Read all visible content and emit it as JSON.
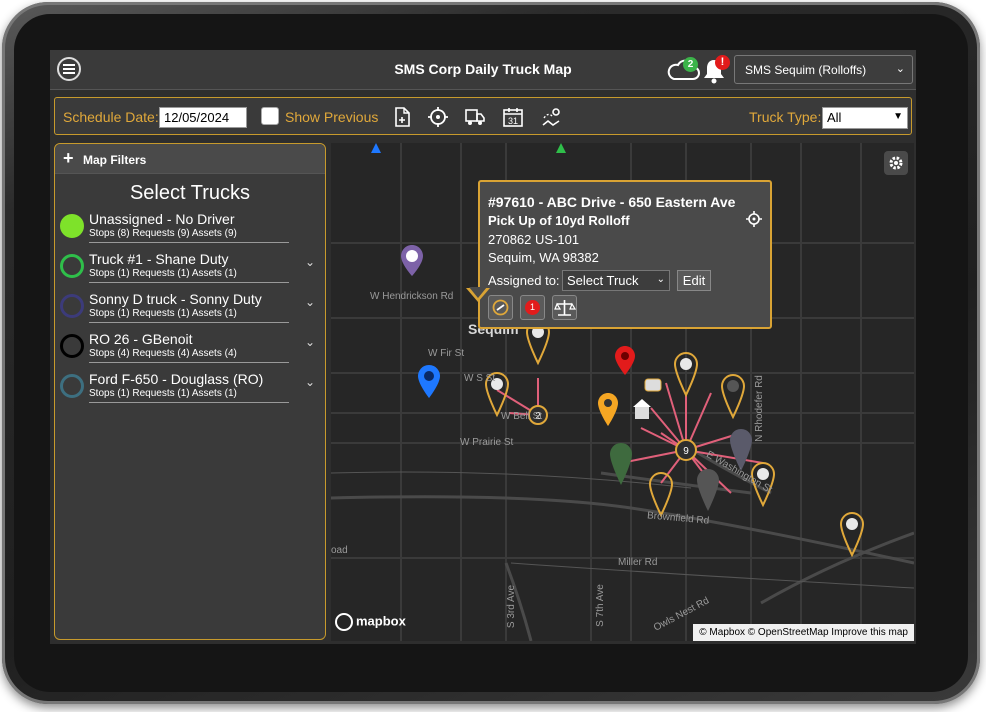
{
  "app": {
    "title": "SMS Corp Daily Truck Map",
    "cloud_count": "2",
    "alert_count": "!",
    "location": "SMS Sequim (Rolloffs)"
  },
  "toolbar": {
    "schedule_label": "Schedule Date:",
    "schedule_date": "12/05/2024",
    "show_previous_label": "Show Previous",
    "truck_type_label": "Truck Type:",
    "truck_type_value": "All"
  },
  "sidebar": {
    "filters_label": "Map Filters",
    "heading": "Select Trucks",
    "trucks": [
      {
        "name": "Unassigned - No Driver",
        "stats": "Stops (8) Requests (9) Assets (9)",
        "color": "#7ee22a",
        "filled": true,
        "expandable": false
      },
      {
        "name": "Truck #1 - Shane Duty",
        "stats": "Stops (1) Requests (1) Assets (1)",
        "color": "#2fbf4a",
        "filled": false,
        "expandable": true
      },
      {
        "name": "Sonny D truck - Sonny Duty",
        "stats": "Stops (1) Requests (1) Assets (1)",
        "color": "#3c3b7a",
        "filled": false,
        "expandable": true
      },
      {
        "name": "RO 26 - GBenoit",
        "stats": "Stops (4) Requests (4) Assets (4)",
        "color": "#000000",
        "filled": false,
        "expandable": true
      },
      {
        "name": "Ford F-650 - Douglass (RO)",
        "stats": "Stops (1) Requests (1) Assets (1)",
        "color": "#3d6f80",
        "filled": false,
        "expandable": true
      }
    ]
  },
  "map": {
    "town": "Sequim",
    "streets": {
      "hendrickson": "W Hendrickson Rd",
      "fir": "W Fir St",
      "w_st": "W S   St",
      "bell": "W Bell St",
      "prairie": "W Prairie St",
      "washington": "E Washington St",
      "brownfield": "Brownfield Rd",
      "rhodefer": "N Rhodefer Rd",
      "miller": "Miller Rd",
      "owls_nest": "Owls Nest Rd",
      "s3rd": "S 3rd Ave",
      "s7th": "S 7th Ave",
      "road": "oad"
    },
    "cluster_a": "2",
    "cluster_b": "9",
    "attribution": "© Mapbox © OpenStreetMap  Improve this map",
    "logo": "mapbox"
  },
  "popup": {
    "title": "#97610 - ABC Drive - 650 Eastern Ave",
    "subtitle": "Pick Up of 10yd Rolloff",
    "address1": "270862 US-101",
    "address2": "Sequim, WA 98382",
    "assigned_label": "Assigned to:",
    "truck_select": "Select Truck",
    "edit_label": "Edit",
    "badge_count": "1"
  },
  "colors": {
    "accent": "#d9a334",
    "pin_gold": "#e0a83a",
    "pin_red": "#e21b1b",
    "pin_blue": "#1e78ff",
    "route": "#e0607a"
  }
}
